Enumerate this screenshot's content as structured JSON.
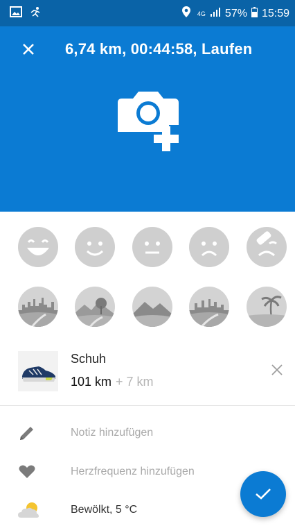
{
  "status_bar": {
    "network": "4G",
    "battery": "57%",
    "time": "15:59"
  },
  "header": {
    "title": "6,74 km, 00:44:58, Laufen"
  },
  "moods": [
    "very-happy-face-icon",
    "happy-face-icon",
    "neutral-face-icon",
    "sad-face-icon",
    "injured-face-icon"
  ],
  "terrains": [
    "city-terrain-icon",
    "park-terrain-icon",
    "hills-terrain-icon",
    "city-road-terrain-icon",
    "beach-terrain-icon"
  ],
  "shoe": {
    "name": "Schuh",
    "km": "101 km",
    "added": "+ 7 km"
  },
  "rows": {
    "note": "Notiz hinzufügen",
    "heart_rate": "Herzfrequenz hinzufügen",
    "weather": "Bewölkt, 5 °C"
  },
  "colors": {
    "header_bg": "#0b7bd3",
    "statusbar_bg": "#0a63a7",
    "accent": "#0b7bd3"
  }
}
